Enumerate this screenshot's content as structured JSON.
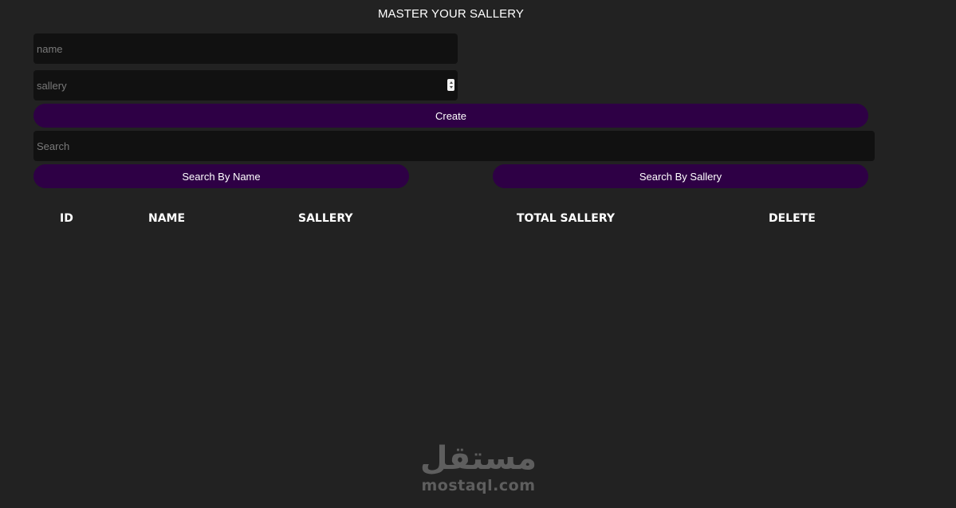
{
  "header": {
    "title": "MASTER YOUR SALLERY"
  },
  "form": {
    "name_placeholder": "name",
    "sallery_placeholder": "sallery",
    "create_label": "Create",
    "search_placeholder": "Search",
    "search_by_name_label": "Search By Name",
    "search_by_sallery_label": "Search By Sallery"
  },
  "table": {
    "columns": [
      "ID",
      "NAME",
      "SALLERY",
      "TOTAL SALLERY",
      "DELETE"
    ],
    "rows": []
  },
  "watermark": {
    "arabic": "مستقل",
    "latin": "mostaql.com"
  },
  "colors": {
    "background": "#222222",
    "input_background": "#111111",
    "button_accent": "#2e0045"
  }
}
